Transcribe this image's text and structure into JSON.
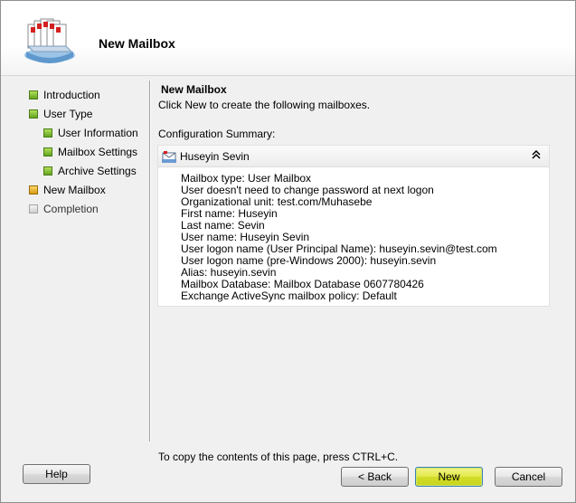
{
  "header": {
    "title": "New Mailbox",
    "icon": "mailboxes-icon"
  },
  "nav": {
    "items": [
      {
        "label": "Introduction",
        "state": "done",
        "level": 0
      },
      {
        "label": "User Type",
        "state": "done",
        "level": 0
      },
      {
        "label": "User Information",
        "state": "done",
        "level": 1
      },
      {
        "label": "Mailbox Settings",
        "state": "done",
        "level": 1
      },
      {
        "label": "Archive Settings",
        "state": "done",
        "level": 1
      },
      {
        "label": "New Mailbox",
        "state": "current",
        "level": 0
      },
      {
        "label": "Completion",
        "state": "pending",
        "level": 0
      }
    ]
  },
  "content": {
    "title": "New Mailbox",
    "description": "Click New to create the following mailboxes.",
    "config_label": "Configuration Summary:",
    "summary": {
      "name": "Huseyin Sevin",
      "lines": [
        "Mailbox type: User Mailbox",
        "User doesn't need to change password at next logon",
        "Organizational unit: test.com/Muhasebe",
        "First name: Huseyin",
        "Last name: Sevin",
        "User name: Huseyin Sevin",
        "User logon name (User Principal Name): huseyin.sevin@test.com",
        "User logon name (pre-Windows 2000): huseyin.sevin",
        "Alias: huseyin.sevin",
        "Mailbox Database: Mailbox Database 0607780426",
        "Exchange ActiveSync mailbox policy: Default"
      ]
    }
  },
  "footer": {
    "copy_hint": "To copy the contents of this page, press CTRL+C.",
    "help_label": "Help",
    "back_label": "< Back",
    "new_label": "New",
    "cancel_label": "Cancel"
  },
  "colors": {
    "done": "#7ab92c",
    "current": "#e0a419",
    "pending": "#d0d0d0",
    "primary_button": "#e0e640"
  }
}
